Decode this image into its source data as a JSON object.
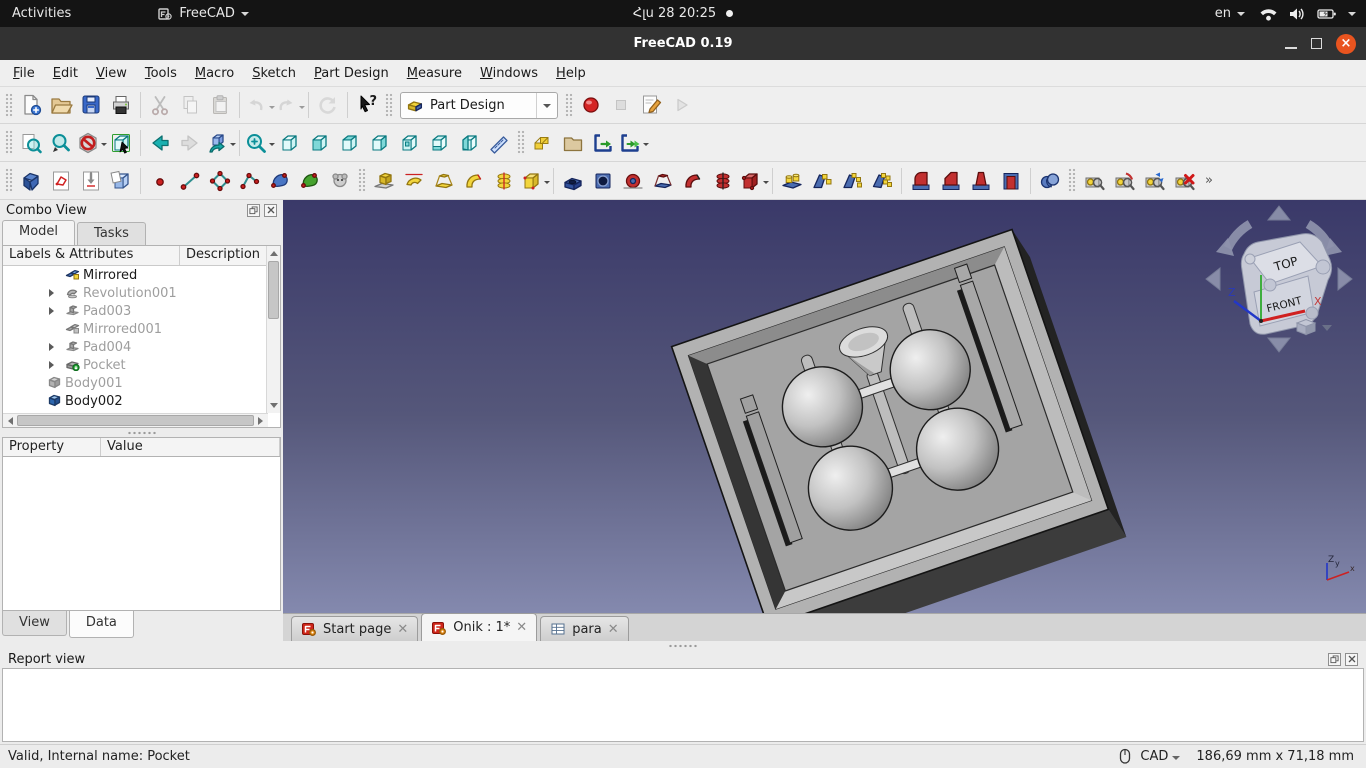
{
  "gnome_bar": {
    "activities": "Activities",
    "app_name": "FreeCAD",
    "clock": "Հլս 28 20:25",
    "locale": "en"
  },
  "window": {
    "title": "FreeCAD 0.19"
  },
  "menu_bar": [
    "File",
    "Edit",
    "View",
    "Tools",
    "Macro",
    "Sketch",
    "Part Design",
    "Measure",
    "Windows",
    "Help"
  ],
  "toolbars": {
    "workbench": {
      "value": "Part Design"
    },
    "overflow": "»",
    "rows": [
      [
        {
          "t": "grip"
        },
        {
          "t": "b",
          "n": "new-file"
        },
        {
          "t": "b",
          "n": "open-file"
        },
        {
          "t": "b",
          "n": "save-file"
        },
        {
          "t": "b",
          "n": "print"
        },
        {
          "t": "sep"
        },
        {
          "t": "b",
          "n": "cut",
          "d": 1
        },
        {
          "t": "b",
          "n": "copy",
          "d": 1
        },
        {
          "t": "b",
          "n": "paste",
          "d": 1
        },
        {
          "t": "sep"
        },
        {
          "t": "b",
          "n": "undo",
          "d": 1,
          "dd": 1
        },
        {
          "t": "b",
          "n": "redo",
          "d": 1,
          "dd": 1
        },
        {
          "t": "sep"
        },
        {
          "t": "b",
          "n": "refresh",
          "d": 1
        },
        {
          "t": "sep"
        },
        {
          "t": "b",
          "n": "whats-this"
        },
        {
          "t": "grip"
        },
        {
          "t": "wb"
        },
        {
          "t": "grip"
        },
        {
          "t": "b",
          "n": "macro-record"
        },
        {
          "t": "b",
          "n": "macro-stop",
          "d": 1
        },
        {
          "t": "b",
          "n": "macro-edit"
        },
        {
          "t": "b",
          "n": "macro-play",
          "d": 1
        }
      ],
      [
        {
          "t": "grip"
        },
        {
          "t": "b",
          "n": "fit-all"
        },
        {
          "t": "b",
          "n": "fit-selection"
        },
        {
          "t": "b",
          "n": "clip-plane",
          "dd": 1
        },
        {
          "t": "b",
          "n": "view-sync"
        },
        {
          "t": "sep"
        },
        {
          "t": "b",
          "n": "nav-back"
        },
        {
          "t": "b",
          "n": "nav-forward",
          "d": 1
        },
        {
          "t": "b",
          "n": "link-go",
          "dd": 1
        },
        {
          "t": "sep"
        },
        {
          "t": "b",
          "n": "zoom",
          "dd": 1
        },
        {
          "t": "b",
          "n": "view-axo"
        },
        {
          "t": "b",
          "n": "view-front"
        },
        {
          "t": "b",
          "n": "view-top"
        },
        {
          "t": "b",
          "n": "view-right"
        },
        {
          "t": "b",
          "n": "view-rear"
        },
        {
          "t": "b",
          "n": "view-bottom"
        },
        {
          "t": "b",
          "n": "view-left"
        },
        {
          "t": "b",
          "n": "measure-distance"
        },
        {
          "t": "grip"
        },
        {
          "t": "b",
          "n": "part-create"
        },
        {
          "t": "b",
          "n": "group-create"
        },
        {
          "t": "b",
          "n": "link-make"
        },
        {
          "t": "b",
          "n": "link-group",
          "dd": 1
        }
      ],
      [
        {
          "t": "grip"
        },
        {
          "t": "b",
          "n": "body-create"
        },
        {
          "t": "b",
          "n": "sketch-create"
        },
        {
          "t": "b",
          "n": "sketch-edit"
        },
        {
          "t": "b",
          "n": "sketch-map"
        },
        {
          "t": "sep"
        },
        {
          "t": "b",
          "n": "sk-point"
        },
        {
          "t": "b",
          "n": "sk-line"
        },
        {
          "t": "b",
          "n": "sk-rect"
        },
        {
          "t": "b",
          "n": "sk-polyline"
        },
        {
          "t": "b",
          "n": "sk-bspline"
        },
        {
          "t": "b",
          "n": "sk-bspline-per"
        },
        {
          "t": "b",
          "n": "sk-carbon-copy"
        },
        {
          "t": "grip"
        },
        {
          "t": "b",
          "n": "pad"
        },
        {
          "t": "b",
          "n": "revolution"
        },
        {
          "t": "b",
          "n": "loft"
        },
        {
          "t": "b",
          "n": "pipe"
        },
        {
          "t": "b",
          "n": "helix"
        },
        {
          "t": "b",
          "n": "primitive-add",
          "dd": 1
        },
        {
          "t": "sep"
        },
        {
          "t": "b",
          "n": "pocket"
        },
        {
          "t": "b",
          "n": "hole"
        },
        {
          "t": "b",
          "n": "groove"
        },
        {
          "t": "b",
          "n": "loft-sub"
        },
        {
          "t": "b",
          "n": "pipe-sub"
        },
        {
          "t": "b",
          "n": "helix-sub"
        },
        {
          "t": "b",
          "n": "primitive-sub",
          "dd": 1
        },
        {
          "t": "sep"
        },
        {
          "t": "b",
          "n": "pattern-mirror"
        },
        {
          "t": "b",
          "n": "pattern-linear"
        },
        {
          "t": "b",
          "n": "pattern-polar"
        },
        {
          "t": "b",
          "n": "pattern-multi"
        },
        {
          "t": "sep"
        },
        {
          "t": "b",
          "n": "fillet"
        },
        {
          "t": "b",
          "n": "chamfer"
        },
        {
          "t": "b",
          "n": "draft"
        },
        {
          "t": "b",
          "n": "thickness"
        },
        {
          "t": "sep"
        },
        {
          "t": "b",
          "n": "boolean"
        },
        {
          "t": "grip"
        },
        {
          "t": "b",
          "n": "meas-linear"
        },
        {
          "t": "b",
          "n": "meas-angular"
        },
        {
          "t": "b",
          "n": "meas-refresh"
        },
        {
          "t": "b",
          "n": "meas-clear"
        },
        {
          "t": "ovf"
        }
      ]
    ]
  },
  "combo_view": {
    "title": "Combo View",
    "tabs": [
      "Model",
      "Tasks"
    ],
    "tree_headers": [
      "Labels & Attributes",
      "Description"
    ],
    "tree": [
      {
        "label": "Mirrored",
        "icon": "mirrored",
        "level": 2,
        "arrow": false,
        "disabled": false
      },
      {
        "label": "Revolution001",
        "icon": "revolution-g",
        "level": 2,
        "arrow": true,
        "disabled": true
      },
      {
        "label": "Pad003",
        "icon": "pad-g",
        "level": 2,
        "arrow": true,
        "disabled": true
      },
      {
        "label": "Mirrored001",
        "icon": "mirrored-g",
        "level": 2,
        "arrow": false,
        "disabled": true
      },
      {
        "label": "Pad004",
        "icon": "pad-g",
        "level": 2,
        "arrow": true,
        "disabled": true
      },
      {
        "label": "Pocket",
        "icon": "pocket-g",
        "level": 2,
        "arrow": true,
        "disabled": true
      },
      {
        "label": "Body001",
        "icon": "body-g",
        "level": 1,
        "arrow": false,
        "disabled": true
      },
      {
        "label": "Body002",
        "icon": "body-b",
        "level": 1,
        "arrow": false,
        "disabled": false
      }
    ],
    "property": {
      "headers": [
        "Property",
        "Value"
      ],
      "tabs": [
        "View",
        "Data"
      ]
    }
  },
  "mdi_tabs": [
    {
      "label": "Start page",
      "icon": "freecad",
      "active": false
    },
    {
      "label": "Onik : 1*",
      "icon": "freecad",
      "active": true
    },
    {
      "label": "para",
      "icon": "spreadsheet",
      "active": false
    }
  ],
  "report_view": {
    "title": "Report view"
  },
  "status_bar": {
    "message": "Valid, Internal name: Pocket",
    "nav_style": "CAD",
    "dimensions": "186,69 mm x 71,18 mm"
  },
  "viewport": {
    "nav_cube": {
      "top_label": "TOP",
      "front_label": "FRONT",
      "z_label": "Z",
      "x_label": "X"
    },
    "axis": {
      "z": "Z",
      "y": "y",
      "x": "x"
    }
  }
}
